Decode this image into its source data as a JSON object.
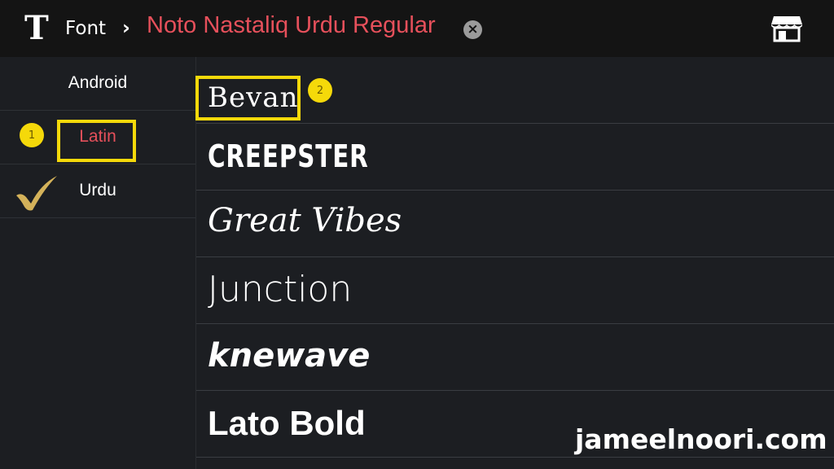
{
  "header": {
    "logo": "T",
    "breadcrumb_root": "Font",
    "breadcrumb_sep": "›",
    "current_font": "Noto Nastaliq Urdu Regular",
    "clear_symbol": "×",
    "store_icon": "store-icon"
  },
  "categories": [
    {
      "label": "Android"
    },
    {
      "label": "Latin",
      "active": true,
      "badge": "1"
    },
    {
      "label": "Urdu",
      "checked": true
    }
  ],
  "fonts": [
    {
      "name": "Bevan",
      "badge": "2"
    },
    {
      "name": "CREEPSTER"
    },
    {
      "name": "Great Vibes"
    },
    {
      "name": "Junction"
    },
    {
      "name": "knewave"
    },
    {
      "name": "Lato Bold"
    }
  ],
  "watermark": "jameelnoori.com",
  "colors": {
    "accent": "#e6505b",
    "highlight": "#f5d90a",
    "background": "#1c1e22",
    "topbar": "#141414",
    "check": "#d4b25a"
  }
}
